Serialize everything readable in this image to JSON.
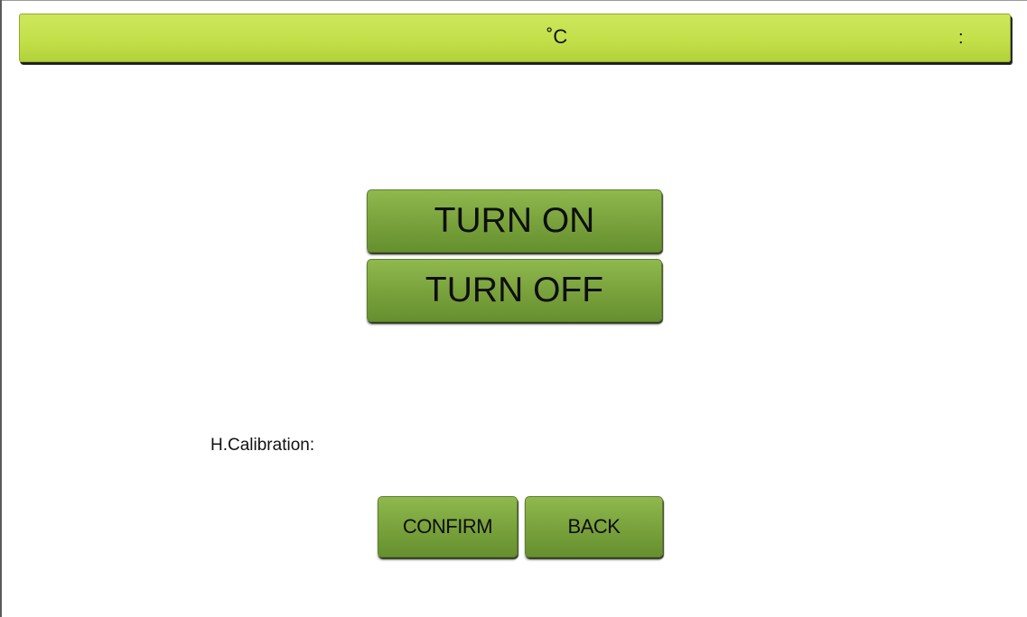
{
  "status_bar": {
    "temperature_unit": "˚C",
    "time_separator": ":",
    "color": "#c3e04a"
  },
  "controls": {
    "turn_on_label": "TURN ON",
    "turn_off_label": "TURN OFF",
    "button_color": "#7aa33d"
  },
  "calibration": {
    "label": "H.Calibration:"
  },
  "actions": {
    "confirm_label": "CONFIRM",
    "back_label": "BACK"
  }
}
